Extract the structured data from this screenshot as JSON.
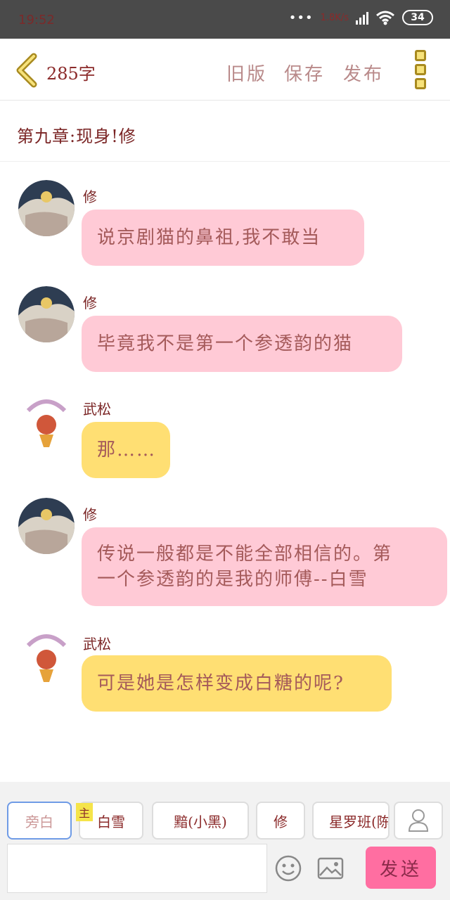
{
  "status_bar": {
    "time": "19:52",
    "dots": "•••",
    "speed": "1.8K/s",
    "battery": "34"
  },
  "toolbar": {
    "word_count": "285字",
    "old_version": "旧版",
    "save": "保存",
    "publish": "发布"
  },
  "chapter": {
    "title": "第九章:现身!修"
  },
  "messages": [
    {
      "sender": "修",
      "text": "说京剧猫的鼻祖,我不敢当",
      "color": "pink"
    },
    {
      "sender": "修",
      "text": "毕竟我不是第一个参透韵的猫",
      "color": "pink"
    },
    {
      "sender": "武松",
      "text": "那……",
      "color": "yellow"
    },
    {
      "sender": "修",
      "text_line1": "传说一般都是不能全部相信的。第",
      "text_line2": "一个参透韵的是我的师傅--白雪",
      "color": "pink"
    },
    {
      "sender": "武松",
      "text": "可是她是怎样变成白糖的呢?",
      "color": "yellow"
    }
  ],
  "roles": [
    "旁白",
    "白雪",
    "黯(小黑)",
    "修",
    "星罗班(陈"
  ],
  "main_badge": "主",
  "send_label": "发送",
  "colors": {
    "pink_bubble": "#ffcad6",
    "yellow_bubble": "#ffdf73",
    "send_button": "#ff6ea1",
    "menu_icon": "#f7e27a"
  }
}
